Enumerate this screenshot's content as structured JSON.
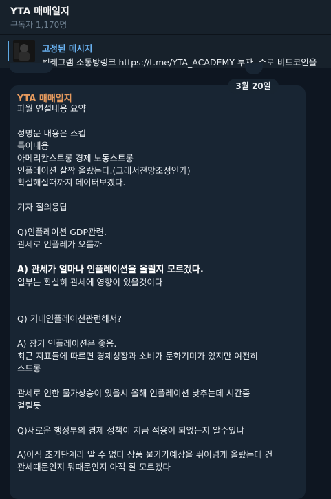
{
  "channel": {
    "title": "YTA 매매일지",
    "subscribers": "구독자 1,170명"
  },
  "pinned": {
    "title": "고정된 메시지",
    "text": "텔레그램 소통방링크 https://t.me/YTA_ACADEMY 투자, 주로 비트코인을"
  },
  "date_label": "3월 20일",
  "message": {
    "sender": "YTA 매매일지",
    "intro": "파월 연설내용 요약\n\n성명문 내용은 스킵\n특이내용\n아메리칸스트롱 경제 노동스트롱\n인플레이션 살짝 올랐는다.(그래서전망조정인가)\n확실해질때까지 데이터보겠다.\n\n기자 질의응답\n\nQ)인플레이션 GDP관련.\n관세로 인플레가 오를까\n\n",
    "bold_answer": "A) 관세가 얼마나 인플레이션을 올릴지 모르겠다.",
    "rest": "\n일부는 확실히 관세에 영향이 있을것이다\n\n\nQ) 기대인플레이션관련해서?\n\nA) 장기 인플레이션은 좋음.\n최근 지표들에 따르면 경제성장과 소비가 둔화기미가 있지만 여전히\n스트롱\n\n관세로 인한 물가상승이 있을시 올해 인플레이션 낮추는데 시간좀\n걸릴듯\n\nQ)새로운 행정부의 경제 정책이 지금 적용이 되었는지 알수있냐\n\nA)아직 초기단계라 알 수 없다 상품 물가가예상을 뛰어넘게 올랐는데 건\n관세때문인지 뭐때문인지 아직 잘 모르겠다"
  }
}
